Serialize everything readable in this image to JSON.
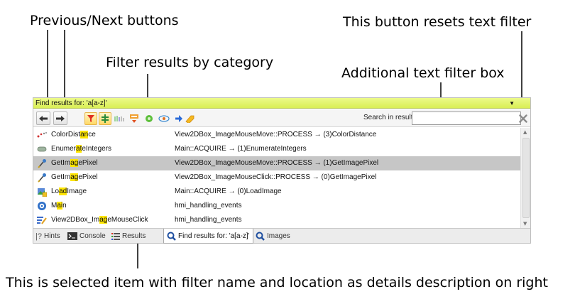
{
  "annotations": {
    "prev_next": "Previous/Next buttons",
    "reset_filter": "This button resets text filter",
    "filter_category": "Filter results by category",
    "text_filter_box": "Additional text filter box",
    "selected_item": "This is selected item with filter name and location as details description on right"
  },
  "panel": {
    "title": "Find results for: 'a[a-z]'",
    "search_label": "Search in results:",
    "search_value": "",
    "search_placeholder": "",
    "filter_icons": [
      "filter-icon",
      "columns-icon",
      "bars-icon",
      "reduce-icon",
      "gear-green-icon",
      "eye-icon",
      "arrow-icon",
      "tag-icon"
    ]
  },
  "results": [
    {
      "icon": "scatter-icon",
      "name": [
        "ColorDist",
        "an",
        "ce"
      ],
      "detail": "View2DBox_ImageMouseMove::PROCESS → (3)ColorDistance",
      "selected": false
    },
    {
      "icon": "pill-icon",
      "name": [
        "Enumer",
        "at",
        "eIntegers"
      ],
      "detail": "Main::ACQUIRE → (1)EnumerateIntegers",
      "selected": false
    },
    {
      "icon": "eyedropper-icon",
      "name": [
        "GetIm",
        "ag",
        "ePixel"
      ],
      "detail": "View2DBox_ImageMouseMove::PROCESS → (1)GetImagePixel",
      "selected": true
    },
    {
      "icon": "eyedropper-icon",
      "name": [
        "GetIm",
        "ag",
        "ePixel"
      ],
      "detail": "View2DBox_ImageMouseClick::PROCESS → (0)GetImagePixel",
      "selected": false
    },
    {
      "icon": "load-image-icon",
      "name": [
        "Lo",
        "ad",
        "Image"
      ],
      "detail": "Main::ACQUIRE → (0)LoadImage",
      "selected": false
    },
    {
      "icon": "gear-blue-icon",
      "name": [
        "M",
        "ai",
        "n"
      ],
      "detail": "hmi_handling_events",
      "selected": false
    },
    {
      "icon": "bars-pen-icon",
      "name": [
        "View2DBox_Im",
        "ag",
        "eMouseClick"
      ],
      "detail": "hmi_handling_events",
      "selected": false
    }
  ],
  "tabs": [
    {
      "label": "Hints",
      "icon": "help-icon",
      "active": false
    },
    {
      "label": "Console",
      "icon": "console-icon",
      "active": false
    },
    {
      "label": "Results",
      "icon": "list-icon",
      "active": false
    },
    {
      "label": "Find results for: 'a[a-z]'",
      "icon": "search-icon",
      "active": true
    },
    {
      "label": "Images",
      "icon": "search-icon",
      "active": false
    }
  ]
}
